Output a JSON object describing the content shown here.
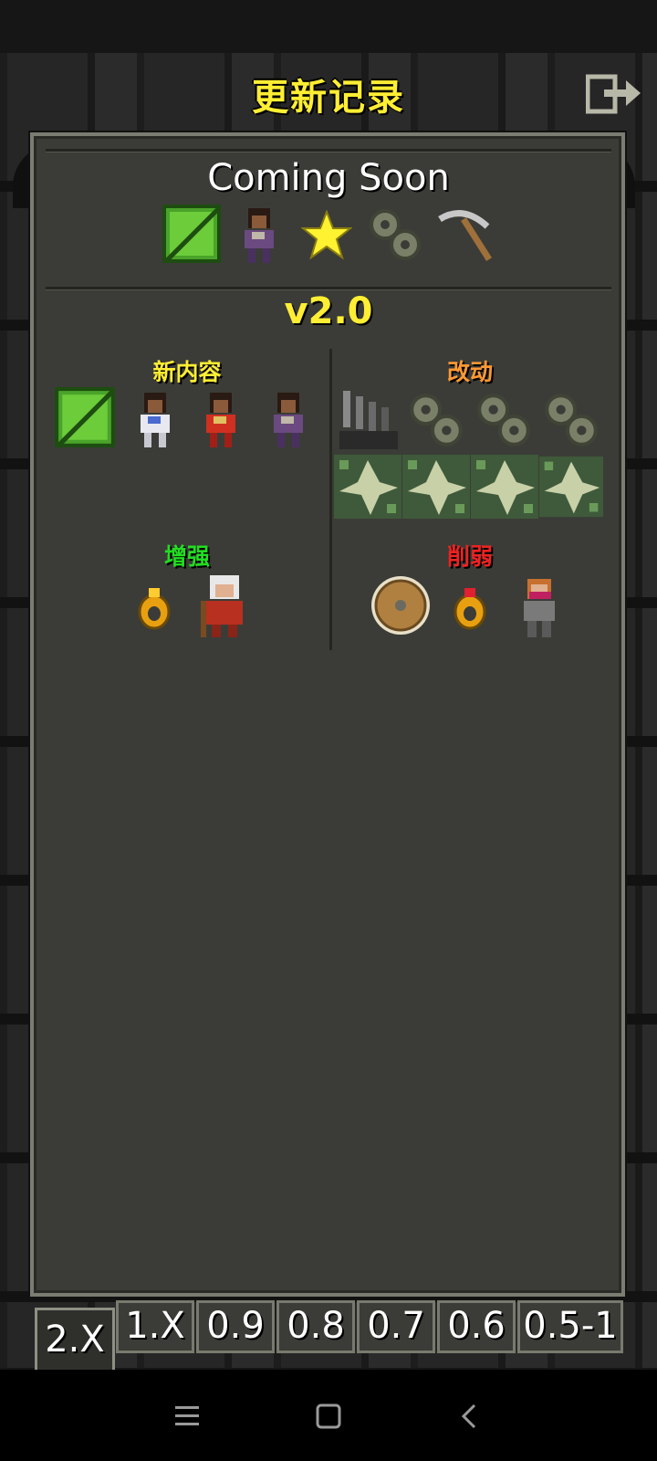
{
  "header": {
    "title": "更新记录",
    "exit_icon": "exit-icon"
  },
  "coming_soon": {
    "heading": "Coming Soon",
    "icons": [
      "green-leaf-icon",
      "huntress-hero-icon",
      "star-icon",
      "gears-icon",
      "pickaxe-icon"
    ]
  },
  "version": {
    "label": "v2.0",
    "sections": {
      "new_content": {
        "label": "新内容",
        "color": "#ffee33",
        "icons": [
          "green-leaf-icon",
          "huntress-white-icon",
          "huntress-red-icon",
          "huntress-purple-icon"
        ]
      },
      "changes": {
        "label": "改动",
        "color": "#ff9933",
        "icons": [
          "dark-pillars-icon",
          "gears-icon",
          "gears-icon",
          "gears-icon",
          "vine-creature-icon",
          "vine-creature-icon",
          "vine-creature-icon",
          "vine-creature-icon"
        ]
      },
      "buffs": {
        "label": "增强",
        "color": "#22dd22",
        "icons": [
          "amber-ring-icon",
          "old-mage-icon"
        ]
      },
      "nerfs": {
        "label": "削弱",
        "color": "#ee2222",
        "icons": [
          "round-shield-icon",
          "ruby-ring-icon",
          "masked-rogue-icon"
        ]
      }
    }
  },
  "tabs": [
    "2.X",
    "1.X",
    "0.9",
    "0.8",
    "0.7",
    "0.6",
    "0.5-1"
  ],
  "active_tab": "2.X",
  "navbar": {
    "icons": [
      "menu-icon",
      "home-icon",
      "back-icon"
    ]
  }
}
